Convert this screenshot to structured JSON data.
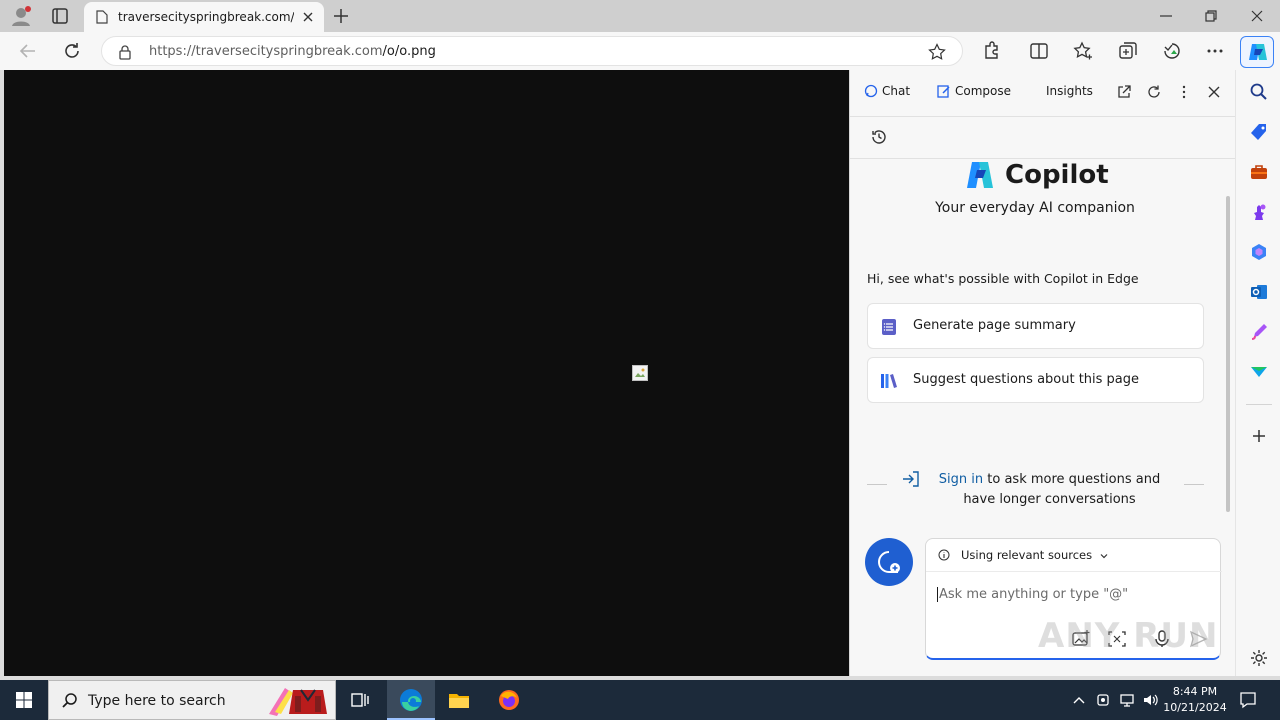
{
  "browser": {
    "tab": {
      "title": "traversecityspringbreak.com/o/o.png"
    },
    "address": {
      "url_host": "https://traversecityspringbreak.com",
      "url_path": "/o/o.png"
    }
  },
  "copilot": {
    "tabs": [
      {
        "label": "Chat"
      },
      {
        "label": "Compose"
      },
      {
        "label": "Insights"
      }
    ],
    "brand": "Copilot",
    "tagline": "Your everyday AI companion",
    "hint": "Hi, see what's possible with Copilot in Edge",
    "suggestions": [
      {
        "label": "Generate page summary"
      },
      {
        "label": "Suggest questions about this page"
      }
    ],
    "signin": {
      "link": "Sign in",
      "rest": " to ask more questions and have longer conversations"
    },
    "composer": {
      "sources_label": "Using relevant sources",
      "placeholder": "Ask me anything or type \"@\""
    },
    "watermark": "ANY RUN"
  },
  "taskbar": {
    "search_placeholder": "Type here to search",
    "time": "8:44 PM",
    "date": "10/21/2024"
  },
  "colors": {
    "accent": "#2563eb",
    "taskbar": "#1c2a3a",
    "link": "#115ea3"
  }
}
